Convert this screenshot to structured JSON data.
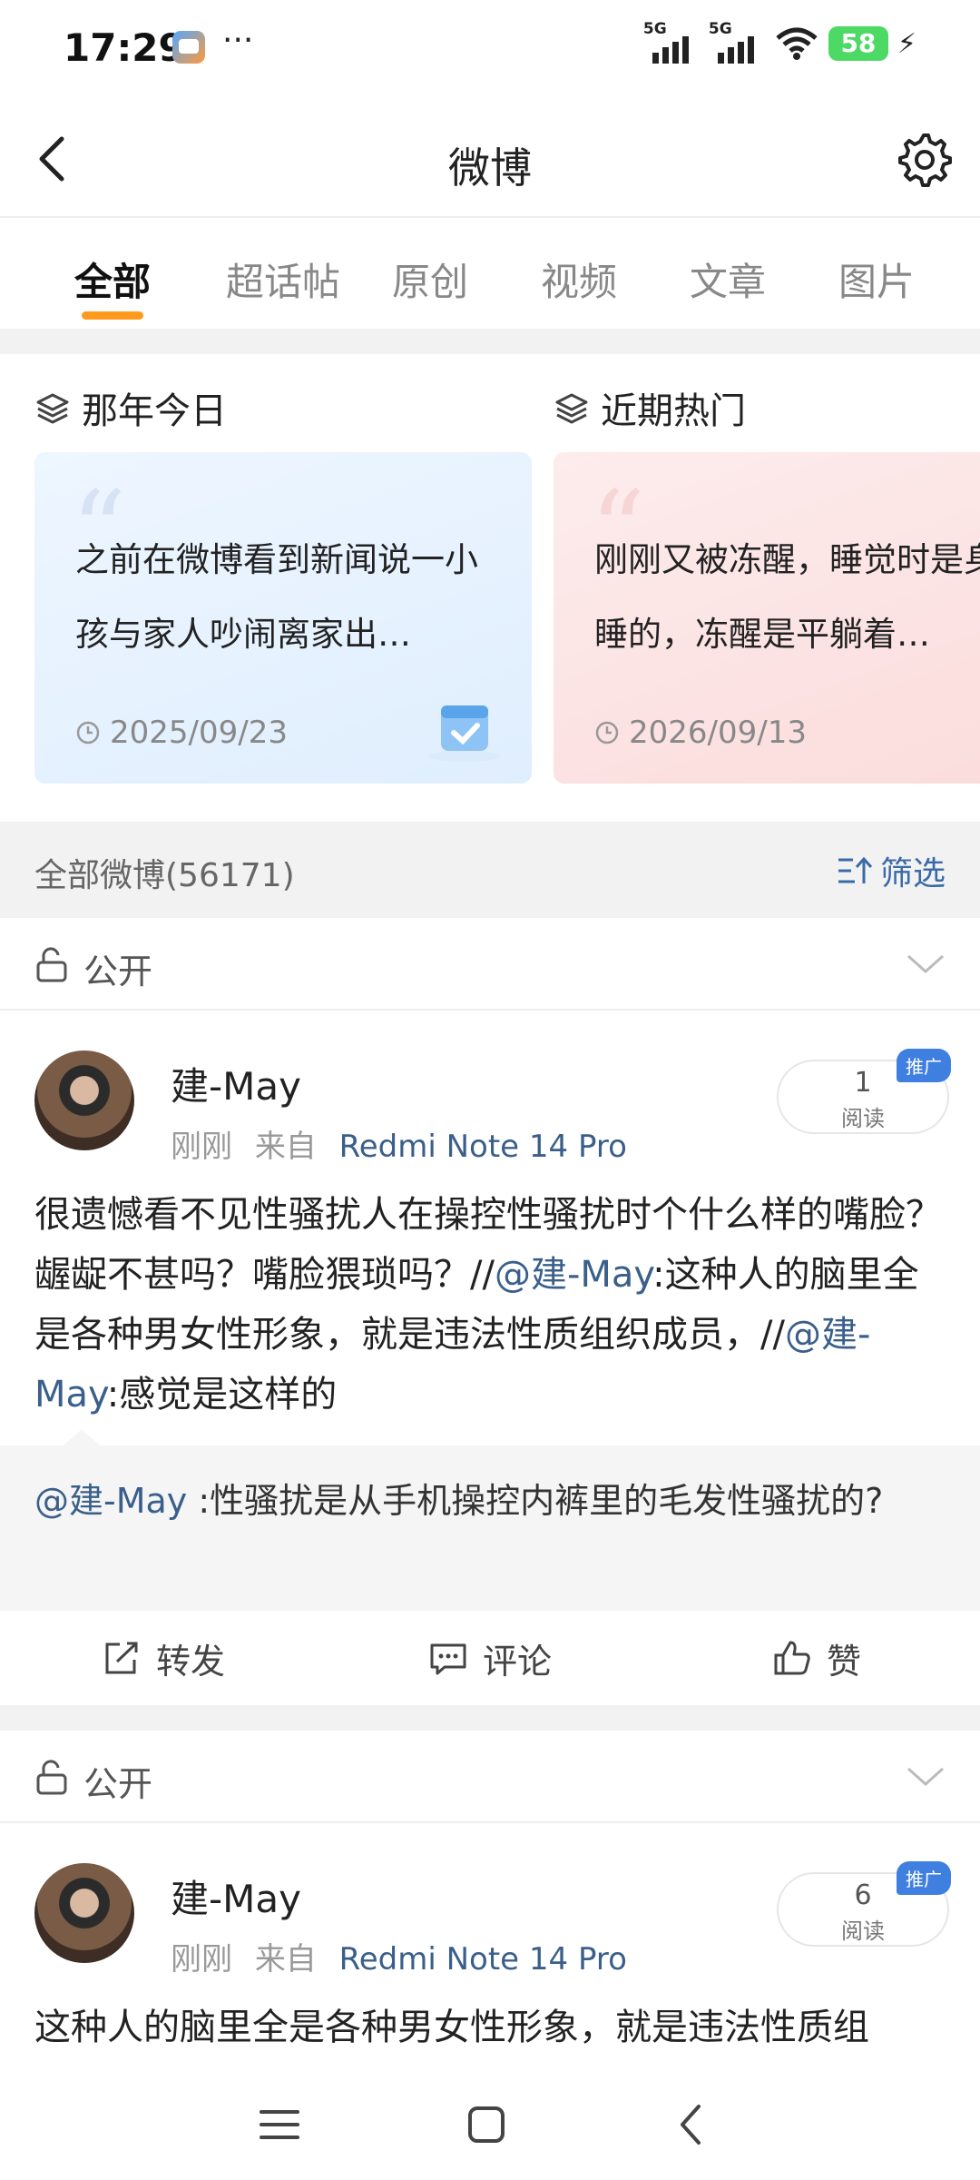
{
  "status_bar": {
    "time": "17:29",
    "more": "···",
    "signal1": "5G",
    "signal2": "5G",
    "battery": "58"
  },
  "header": {
    "title": "微博"
  },
  "tabs": [
    {
      "label": "全部",
      "active": true
    },
    {
      "label": "超话帖",
      "active": false
    },
    {
      "label": "原创",
      "active": false
    },
    {
      "label": "视频",
      "active": false
    },
    {
      "label": "文章",
      "active": false
    },
    {
      "label": "图片",
      "active": false
    }
  ],
  "highlights": {
    "left": {
      "heading": "那年今日",
      "text": "之前在微博看到新闻说一小孩与家人吵闹离家出…",
      "date": "2025/09/23"
    },
    "right": {
      "heading": "近期热门",
      "text": "刚刚又被冻醒，睡觉时是身睡的，冻醒是平躺着…",
      "date": "2026/09/13"
    }
  },
  "all_weibo": {
    "count_label": "全部微博(56171)",
    "filter_label": "筛选"
  },
  "privacy_label": "公开",
  "posts": [
    {
      "user": "建-May",
      "time": "刚刚",
      "source_prefix": "来自",
      "device": "Redmi Note 14 Pro",
      "reads": "1",
      "reads_label": "阅读",
      "tag": "推广",
      "text_a": "很遗憾看不见性骚扰人在操控性骚扰时个什么样的嘴脸？龌龊不甚吗？嘴脸猥琐吗？//",
      "mention_a": "@建-May",
      "text_b": ":这种人的脑里全是各种男女性形象，就是违法性质组织成员，//",
      "mention_b": "@建-May",
      "text_c": ":感觉是这样的",
      "repost_mention": "@建-May",
      "repost_text": " :性骚扰是从手机操控内裤里的毛发性骚扰的?",
      "actions": {
        "repost": "转发",
        "comment": "评论",
        "like": "赞"
      }
    },
    {
      "user": "建-May",
      "time": "刚刚",
      "source_prefix": "来自",
      "device": "Redmi Note 14 Pro",
      "reads": "6",
      "reads_label": "阅读",
      "tag": "推广",
      "text": "这种人的脑里全是各种男女性形象，就是违法性质组"
    }
  ],
  "colors": {
    "accent": "#ff9a1f",
    "link": "#3a5f8a",
    "tag": "#3f7fe0"
  }
}
